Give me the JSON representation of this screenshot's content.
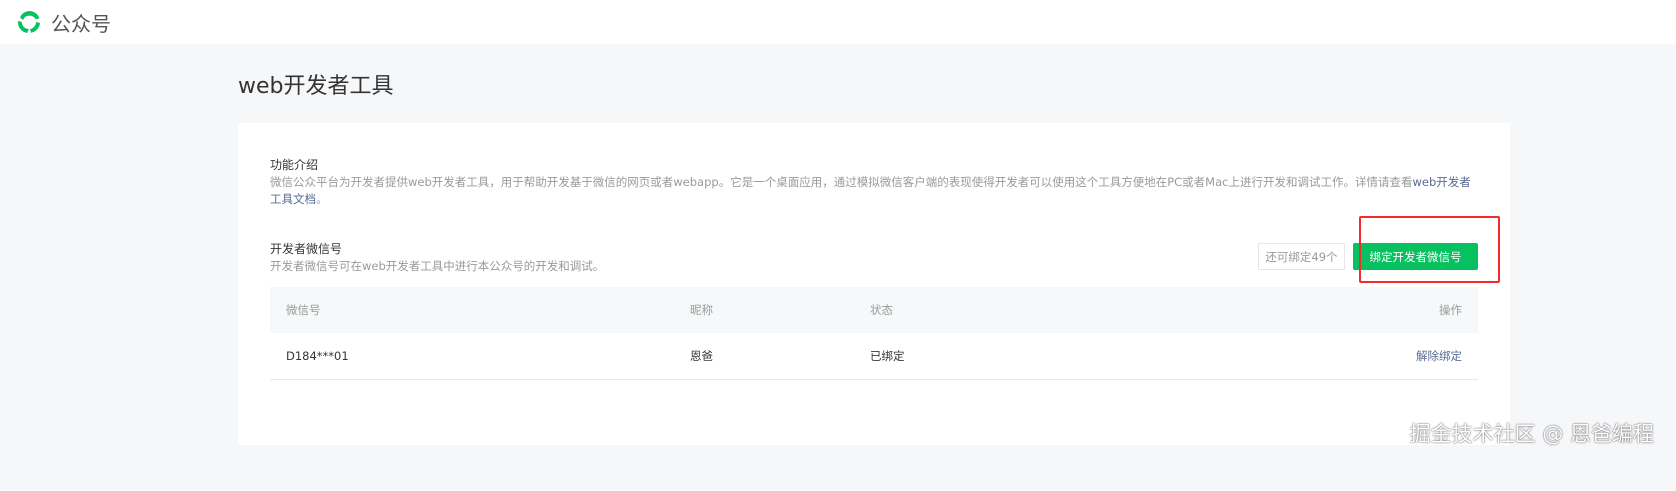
{
  "header": {
    "brand": "公众号"
  },
  "page_title": "web开发者工具",
  "intro": {
    "title": "功能介绍",
    "desc": "微信公众平台为开发者提供web开发者工具，用于帮助开发基于微信的网页或者webapp。它是一个桌面应用，通过模拟微信客户端的表现使得开发者可以使用这个工具方便地在PC或者Mac上进行开发和调试工作。详情请查看",
    "link": "web开发者工具文档",
    "end": "。"
  },
  "dev": {
    "title": "开发者微信号",
    "desc": "开发者微信号可在web开发者工具中进行本公众号的开发和调试。",
    "counter": "还可绑定49个",
    "bind_button": "绑定开发者微信号"
  },
  "table": {
    "headers": [
      "微信号",
      "昵称",
      "状态",
      "操作"
    ],
    "rows": [
      {
        "wechat_id": "D184***01",
        "nickname": "恩爸",
        "status": "已绑定",
        "action": "解除绑定"
      }
    ]
  },
  "watermark": "掘金技术社区 @ 恩爸编程"
}
